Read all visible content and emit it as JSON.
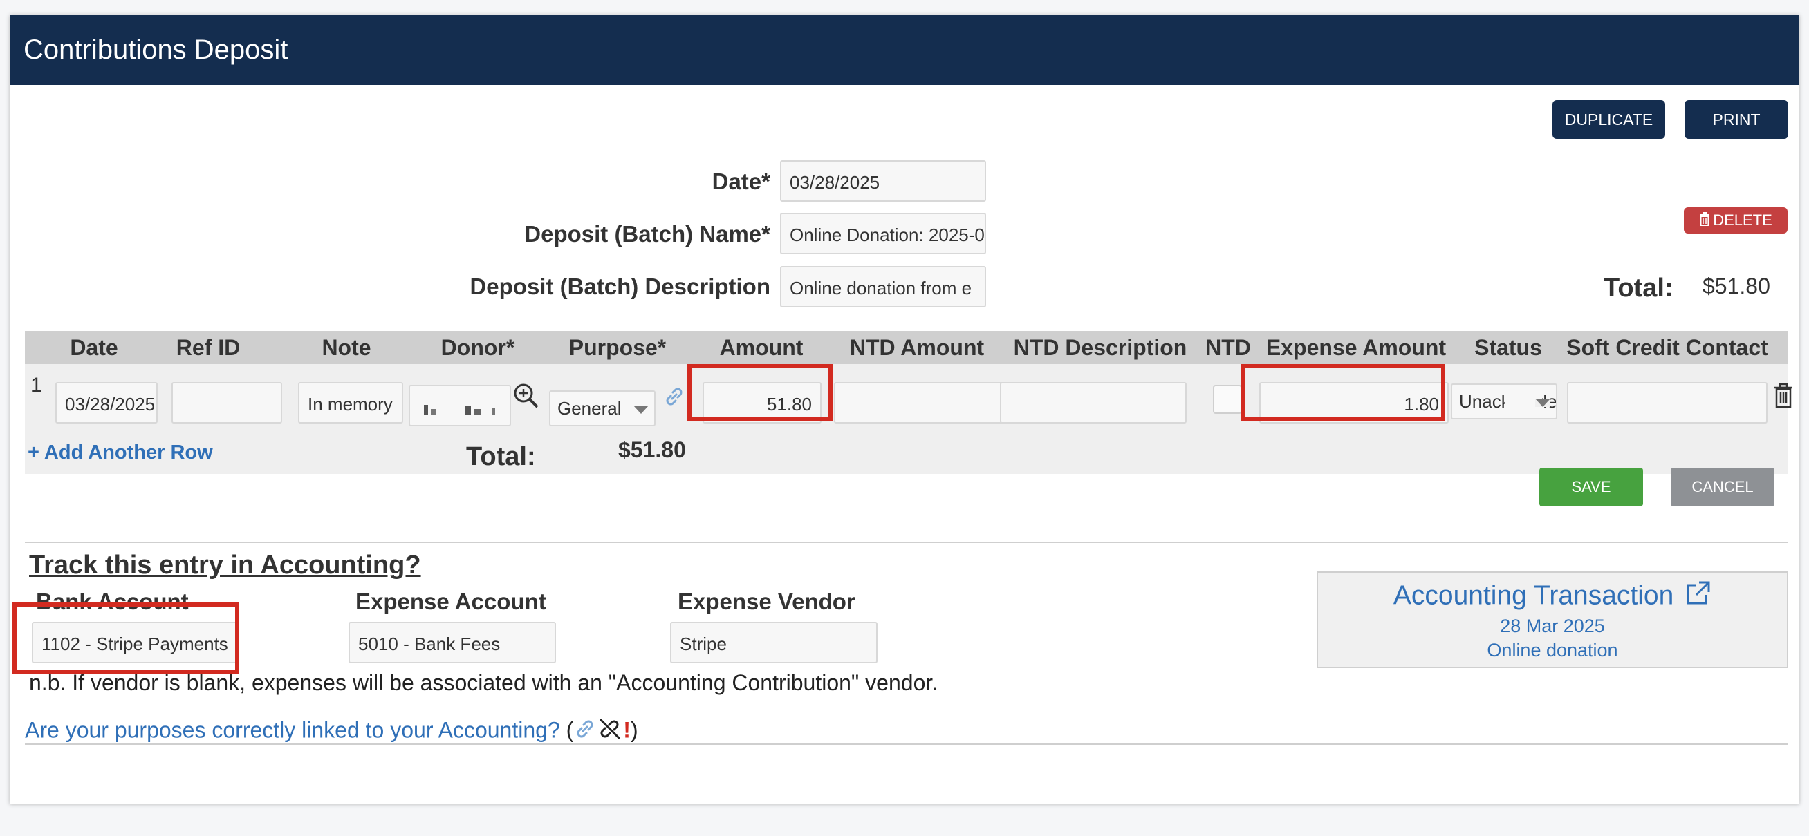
{
  "header": {
    "title": "Contributions Deposit"
  },
  "toolbar": {
    "duplicate_label": "DUPLICATE",
    "print_label": "PRINT",
    "delete_label": "DELETE"
  },
  "form": {
    "date_label": "Date*",
    "date_value": "03/28/2025",
    "batch_name_label": "Deposit (Batch) Name*",
    "batch_name_value": "Online Donation: 2025-0",
    "batch_desc_label": "Deposit (Batch) Description",
    "batch_desc_value": "Online donation from e",
    "total_label": "Total:",
    "total_value": "$51.80"
  },
  "table": {
    "columns": [
      "Date",
      "Ref ID",
      "Note",
      "Donor*",
      "Purpose*",
      "Amount",
      "NTD Amount",
      "NTD Description",
      "NTD",
      "Expense Amount",
      "Status",
      "Soft Credit Contact"
    ],
    "rows": [
      {
        "index": "1",
        "date": "03/28/2025",
        "ref_id": "",
        "note": "In memory",
        "donor": "",
        "purpose": "General",
        "amount": "51.80",
        "ntd_amount": "",
        "ntd_description": "",
        "ntd": false,
        "expense_amount": "1.80",
        "status": "Unacknowledged",
        "soft_credit": ""
      }
    ],
    "add_row_label": "+ Add Another Row",
    "total_label": "Total:",
    "total_value": "$51.80"
  },
  "actions": {
    "save_label": "SAVE",
    "cancel_label": "CANCEL"
  },
  "accounting": {
    "heading": "Track this entry in Accounting?",
    "bank_account_label": "Bank Account",
    "bank_account_value": "1102 - Stripe Payments",
    "expense_account_label": "Expense Account",
    "expense_account_value": "5010 - Bank Fees",
    "expense_vendor_label": "Expense Vendor",
    "expense_vendor_value": "Stripe",
    "note": "n.b. If vendor is blank, expenses will be associated with an \"Accounting Contribution\" vendor.",
    "purposes_link": "Are your purposes correctly linked to your Accounting?",
    "paren_open": "(",
    "paren_close": ")",
    "exclaim": "!",
    "transaction_title": "Accounting Transaction",
    "transaction_date": "28 Mar 2025",
    "transaction_desc": "Online donation"
  },
  "colors": {
    "header_bg": "#142d4f",
    "link": "#2f6fb7",
    "highlight": "#d22a20",
    "save": "#47a23f",
    "delete": "#c44040"
  }
}
